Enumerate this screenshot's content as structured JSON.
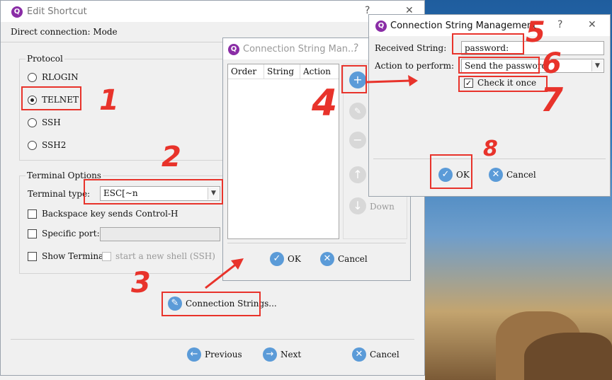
{
  "edit_shortcut": {
    "title": "Edit Shortcut",
    "help_glyph": "?",
    "close_glyph": "✕",
    "header": "Direct connection: Mode",
    "protocol": {
      "group_label": "Protocol",
      "options": [
        "RLOGIN",
        "TELNET",
        "SSH",
        "SSH2"
      ],
      "selected": "TELNET"
    },
    "terminal_options": {
      "group_label": "Terminal Options",
      "terminal_type_label": "Terminal type:",
      "terminal_type_value": "ESC[~n",
      "backspace_label": "Backspace key sends Control-H",
      "specific_port_label": "Specific port:",
      "show_terminal_label": "Show Terminal",
      "new_shell_label": "start a new shell (SSH)"
    },
    "connection_strings_label": "Connection Strings...",
    "previous_label": "Previous",
    "next_label": "Next",
    "cancel_label": "Cancel"
  },
  "connection_string_mid": {
    "title": "Connection String Man...",
    "help_glyph": "?",
    "columns": [
      "Order",
      "String",
      "Action"
    ],
    "down_label": "Down",
    "ok_label": "OK",
    "cancel_label": "Cancel"
  },
  "connection_string_front": {
    "title": "Connection String Management",
    "help_glyph": "?",
    "close_glyph": "✕",
    "received_label": "Received String:",
    "received_value": "password:",
    "action_label": "Action to perform:",
    "action_value": "Send the password",
    "check_once_label": "Check it once",
    "ok_label": "OK",
    "cancel_label": "Cancel"
  },
  "annotations": [
    "1",
    "2",
    "3",
    "4",
    "5",
    "6",
    "7",
    "8"
  ],
  "colors": {
    "annotation": "#e8332b",
    "button_icon": "#5b9bd8",
    "app_icon": "#8a2da6"
  }
}
